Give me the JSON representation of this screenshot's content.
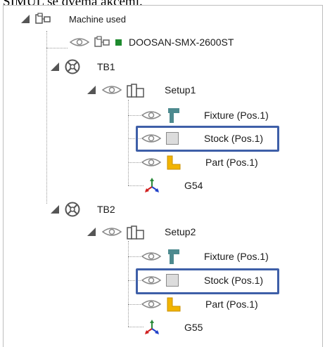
{
  "caption": "SIMUL se dvema akcemi.",
  "tree": {
    "machine_used": "Machine used",
    "machine_model": "DOOSAN-SMX-2600ST",
    "tb1": {
      "label": "TB1",
      "setup": "Setup1",
      "fixture": "Fixture (Pos.1)",
      "stock": "Stock (Pos.1)",
      "part": "Part (Pos.1)",
      "wcs": "G54"
    },
    "tb2": {
      "label": "TB2",
      "setup": "Setup2",
      "fixture": "Fixture (Pos.1)",
      "stock": "Stock (Pos.1)",
      "part": "Part (Pos.1)",
      "wcs": "G55"
    }
  },
  "colors": {
    "highlight_border": "#3e5fa8",
    "fixture_icon": "#4d8a8f",
    "part_icon": "#f2b400",
    "machine_indicator": "#1e8a2e"
  },
  "icons": {
    "expand": "expanded-triangle-icon",
    "visibility": "eye-icon",
    "machine": "machine-icon",
    "turret": "turret-icon",
    "setup": "setup-icon",
    "fixture": "fixture-icon",
    "stock": "stock-icon",
    "part": "part-icon",
    "wcs": "coordinate-system-icon"
  }
}
